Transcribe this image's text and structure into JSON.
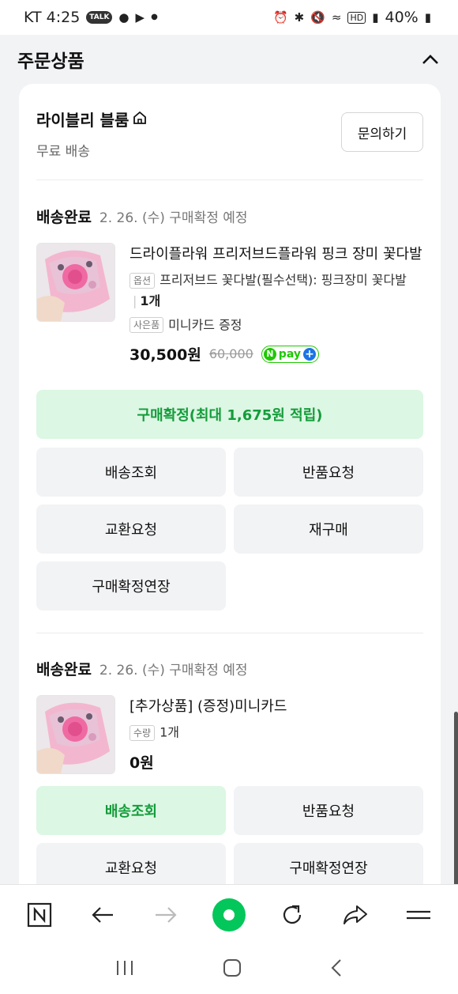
{
  "status_bar": {
    "carrier_time": "KT 4:25",
    "app_badges": [
      "TALK"
    ],
    "battery": "40%",
    "hd_label": "HD"
  },
  "section": {
    "title": "주문상품"
  },
  "shop": {
    "name": "라이블리 블룸",
    "shipping": "무료 배송",
    "inquiry_label": "문의하기"
  },
  "orders": [
    {
      "status": "배송완료",
      "date_note": "2. 26. (수) 구매확정 예정",
      "product_name": "드라이플라워 프리저브드플라워 핑크 장미 꽃다발",
      "option_tag": "옵션",
      "option_text": "프리저브드 꽃다발(필수선택): 핑크장미 꽃다발",
      "option_qty": "1개",
      "gift_tag": "사은품",
      "gift_text": "미니카드 증정",
      "price": "30,500원",
      "original_price": "60,000",
      "npay_label": "pay",
      "primary_button": "구매확정(최대 1,675원 적립)",
      "buttons": [
        "배송조회",
        "반품요청",
        "교환요청",
        "재구매",
        "구매확정연장"
      ]
    },
    {
      "status": "배송완료",
      "date_note": "2. 26. (수) 구매확정 예정",
      "product_name": "[추가상품] (증정)미니카드",
      "qty_tag": "수량",
      "qty_text": "1개",
      "price": "0원",
      "buttons": [
        "배송조회",
        "반품요청",
        "교환요청",
        "구매확정연장"
      ]
    }
  ],
  "browser_bar": {
    "icons": [
      "naver-n-icon",
      "back-arrow-icon",
      "forward-arrow-icon",
      "home-green-icon",
      "refresh-icon",
      "share-icon",
      "menu-icon"
    ]
  },
  "colors": {
    "accent_green": "#149c3b",
    "accent_green_bg": "#dcf7e3",
    "naver_green": "#1ec800"
  }
}
